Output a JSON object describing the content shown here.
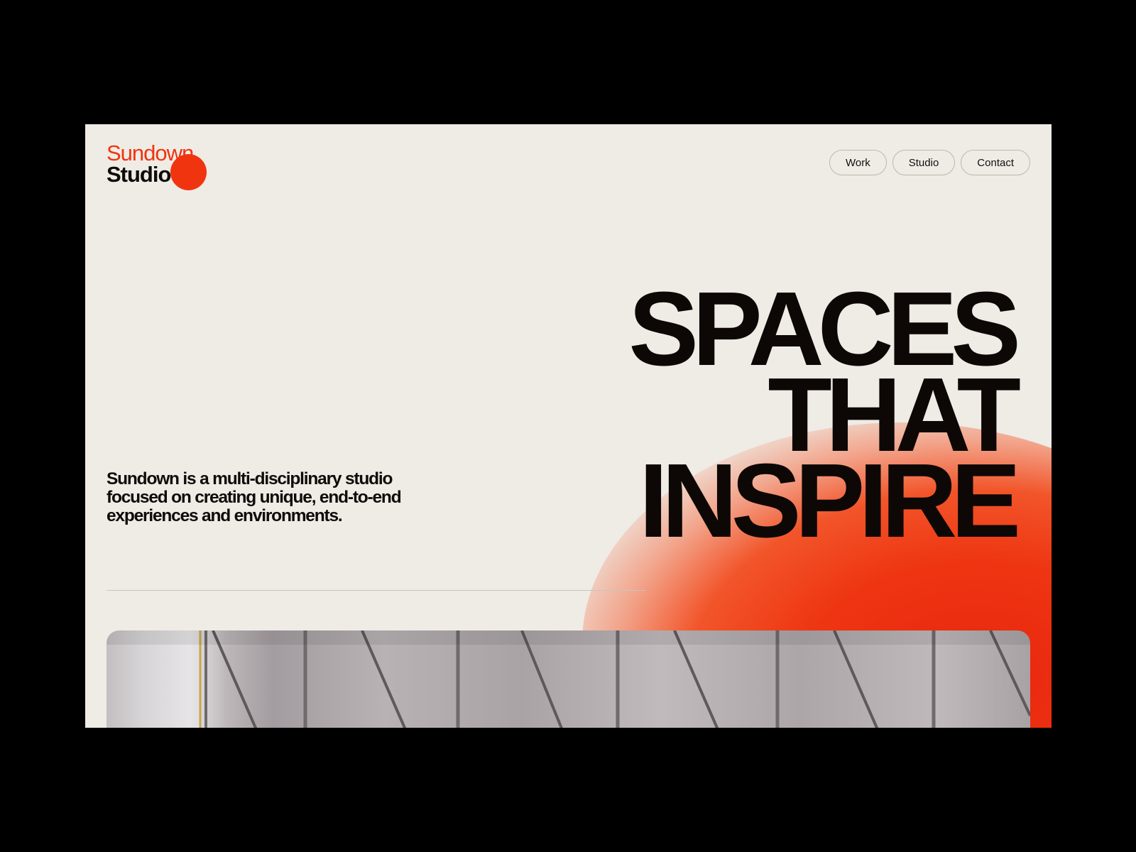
{
  "logo": {
    "line1": "Sundown",
    "line2": "Studio"
  },
  "nav": {
    "items": [
      "Work",
      "Studio",
      "Contact"
    ]
  },
  "hero": {
    "lines": [
      "SPACES",
      "THAT",
      "INSPIRE"
    ]
  },
  "intro": {
    "text": "Sundown is a multi-disciplinary studio focused on creating unique, end-to-end experiences and environments."
  },
  "colors": {
    "accent": "#f0340f",
    "background": "#efebe5",
    "text": "#0e0b09"
  }
}
